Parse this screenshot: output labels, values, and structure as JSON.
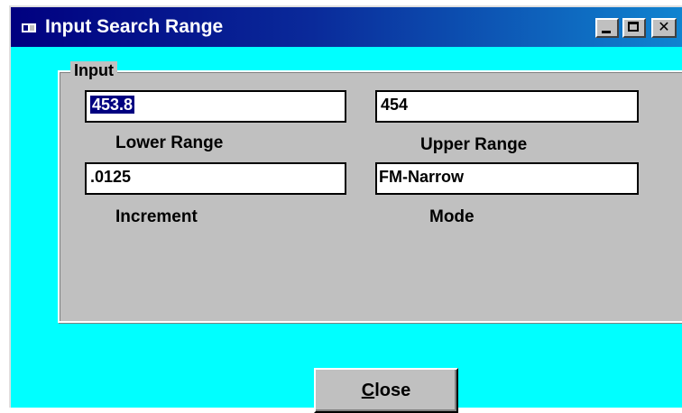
{
  "window": {
    "title": "Input Search Range",
    "icon": "app-window-icon",
    "titlebar_buttons": [
      "minimize",
      "maximize",
      "close"
    ]
  },
  "group": {
    "label": "Input"
  },
  "fields": {
    "lower_range": {
      "value": "453.8",
      "label": "Lower Range",
      "selected": true
    },
    "upper_range": {
      "value": "454",
      "label": "Upper Range"
    },
    "increment": {
      "value": ".0125",
      "label": "Increment"
    },
    "mode": {
      "value": "FM-Narrow",
      "label": "Mode"
    }
  },
  "close_button": {
    "mnemonic": "C",
    "rest": "lose"
  },
  "colors": {
    "client_background": "#00ffff",
    "group_background": "#c0c0c0",
    "titlebar_start": "#000080",
    "titlebar_end": "#1084d0",
    "selection": "#000080"
  }
}
